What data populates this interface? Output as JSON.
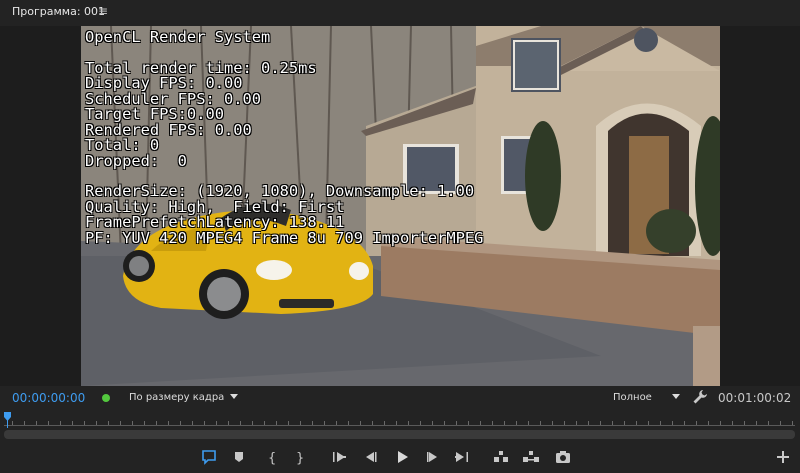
{
  "panel": {
    "title": "Программа: 001",
    "menu_icon": "hamburger-menu-icon"
  },
  "overlay": {
    "header": "OpenCL Render System",
    "stats": [
      "Total render time: 0.25ms",
      "Display FPS: 0.00",
      "Scheduler FPS: 0.00",
      "Target FPS:0.00",
      "Rendered FPS: 0.00",
      "Total: 0",
      "Dropped:  0"
    ],
    "info": [
      "RenderSize: (1920, 1080), Downsample: 1.00",
      "Quality: High,  Field: First",
      "FramePrefetchLatency: 138.11",
      "PF: YUV 420 MPEG4 Frame 8u 709 ImporterMPEG"
    ]
  },
  "controls": {
    "timecode_current": "00:00:00:00",
    "zoom_value": "По размеру кадра",
    "quality_value": "Полное",
    "timecode_duration": "00:01:00:02"
  },
  "toolbar": {
    "buttons": [
      "add-marker-icon",
      "mark-in-icon-marker",
      "mark-in-icon",
      "mark-out-icon",
      "go-to-in-icon",
      "step-back-icon",
      "play-icon",
      "step-forward-icon",
      "go-to-out-icon",
      "lift-icon",
      "extract-icon",
      "export-frame-icon",
      "add-button-icon"
    ]
  },
  "colors": {
    "timecode_accent": "#3e9cf0",
    "status_green": "#53c83e",
    "panel_bg": "#232323"
  }
}
